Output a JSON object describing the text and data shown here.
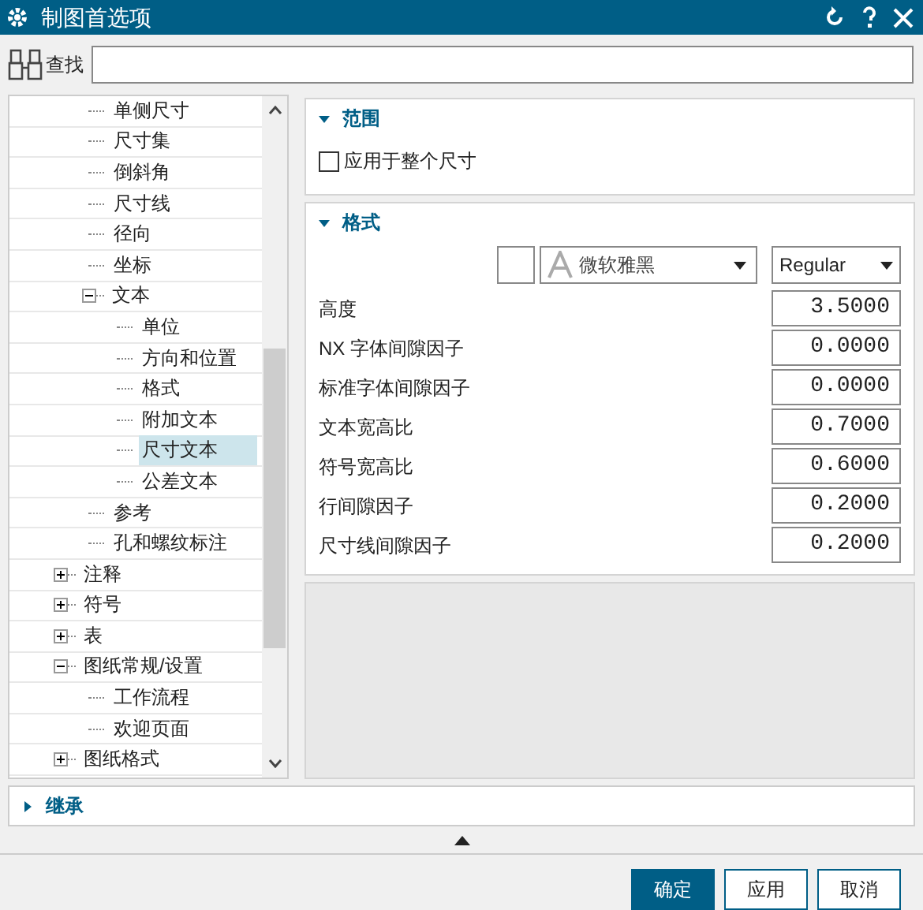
{
  "window": {
    "title": "制图首选项"
  },
  "search": {
    "label": "查找"
  },
  "tree": {
    "partial_branch": [
      {
        "label": "单侧尺寸",
        "selected": false
      },
      {
        "label": "尺寸集",
        "selected": false
      },
      {
        "label": "倒斜角",
        "selected": false
      },
      {
        "label": "尺寸线",
        "selected": false
      },
      {
        "label": "径向",
        "selected": false
      },
      {
        "label": "坐标",
        "selected": false
      },
      {
        "label": "文本",
        "selected": false,
        "expanded": true,
        "children": [
          {
            "label": "单位",
            "selected": false
          },
          {
            "label": "方向和位置",
            "selected": false
          },
          {
            "label": "格式",
            "selected": false
          },
          {
            "label": "附加文本",
            "selected": false
          },
          {
            "label": "尺寸文本",
            "selected": true
          },
          {
            "label": "公差文本",
            "selected": false
          }
        ]
      },
      {
        "label": "参考",
        "selected": false
      },
      {
        "label": "孔和螺纹标注",
        "selected": false
      }
    ],
    "items": [
      {
        "label": "注释",
        "selected": false,
        "expanded": false
      },
      {
        "label": "符号",
        "selected": false,
        "expanded": false
      },
      {
        "label": "表",
        "selected": false,
        "expanded": false
      },
      {
        "label": "图纸常规/设置",
        "selected": false,
        "expanded": true,
        "children": [
          {
            "label": "工作流程",
            "selected": false
          },
          {
            "label": "欢迎页面",
            "selected": false
          }
        ]
      },
      {
        "label": "图纸格式",
        "selected": false,
        "expanded": false
      }
    ]
  },
  "sections": [
    {
      "title": "范围",
      "expanded": true,
      "checkbox": {
        "label": "应用于整个尺寸",
        "checked": false
      }
    },
    {
      "title": "格式",
      "expanded": true,
      "font": {
        "name": "微软雅黑",
        "style": "Regular"
      },
      "fields": [
        {
          "label": "高度",
          "value": "3.5000"
        },
        {
          "label": "NX 字体间隙因子",
          "value": "0.0000"
        },
        {
          "label": "标准字体间隙因子",
          "value": "0.0000"
        },
        {
          "label": "文本宽高比",
          "value": "0.7000"
        },
        {
          "label": "符号宽高比",
          "value": "0.6000"
        },
        {
          "label": "行间隙因子",
          "value": "0.2000"
        },
        {
          "label": "尺寸线间隙因子",
          "value": "0.2000"
        }
      ]
    }
  ],
  "inherit_section": {
    "title": "继承",
    "expanded": false
  },
  "buttons": [
    "确定",
    "应用",
    "取消"
  ]
}
